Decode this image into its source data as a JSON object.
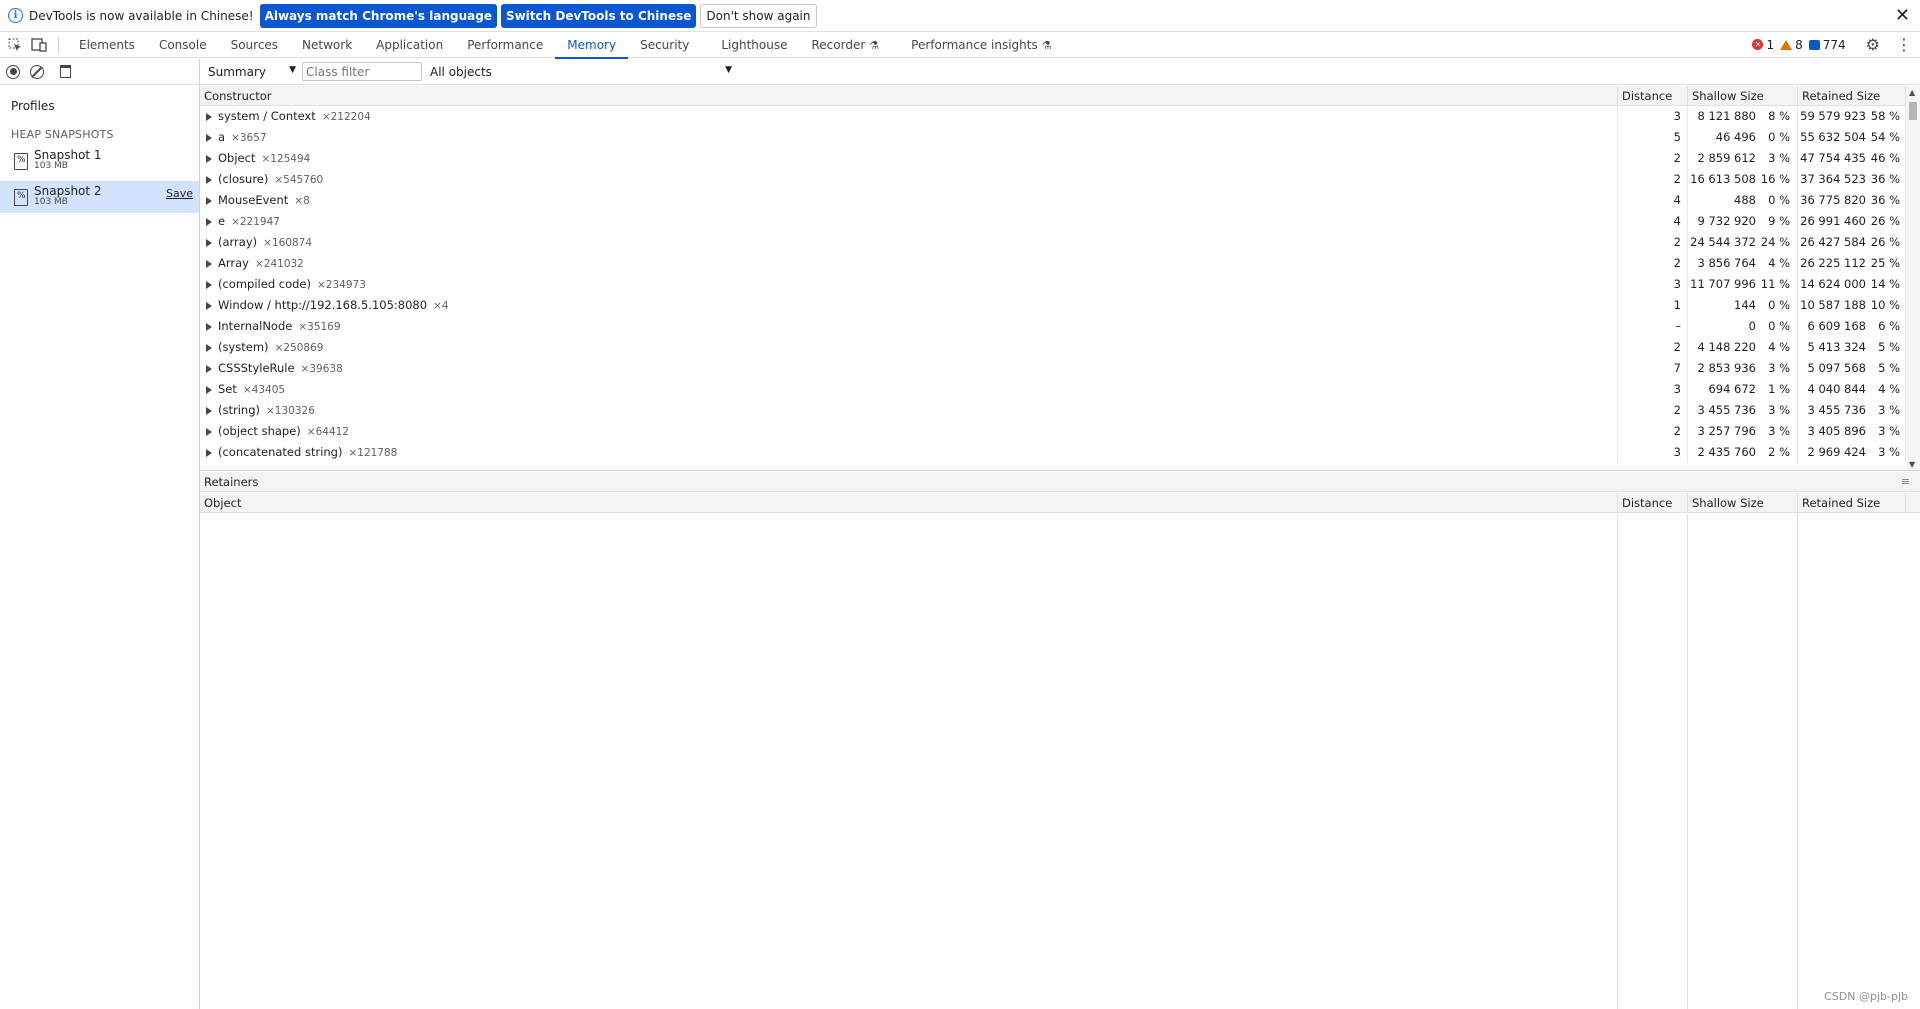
{
  "infobar": {
    "message": "DevTools is now available in Chinese!",
    "btn_match": "Always match Chrome's language",
    "btn_switch": "Switch DevTools to Chinese",
    "btn_dismiss": "Don't show again",
    "close": "✕"
  },
  "tabs": [
    "Elements",
    "Console",
    "Sources",
    "Network",
    "Application",
    "Performance",
    "Memory",
    "Security",
    "Lighthouse",
    "Recorder",
    "Performance insights"
  ],
  "active_tab": "Memory",
  "status": {
    "errors": "1",
    "warnings": "8",
    "messages": "774"
  },
  "sidebar": {
    "profiles": "Profiles",
    "heap_title": "HEAP SNAPSHOTS",
    "snapshots": [
      {
        "name": "Snapshot 1",
        "size": "103 MB"
      },
      {
        "name": "Snapshot 2",
        "size": "103 MB",
        "save": "Save"
      }
    ]
  },
  "toolbar": {
    "view": "Summary",
    "filter_placeholder": "Class filter",
    "objects": "All objects"
  },
  "columns": {
    "constructor": "Constructor",
    "distance": "Distance",
    "shallow": "Shallow Size",
    "retained": "Retained Size"
  },
  "rows": [
    {
      "name": "system / Context",
      "count": "×212204",
      "distance": "3",
      "shallow": "8 121 880",
      "shallow_pct": "8 %",
      "retained": "59 579 923",
      "retained_pct": "58 %"
    },
    {
      "name": "a",
      "count": "×3657",
      "distance": "5",
      "shallow": "46 496",
      "shallow_pct": "0 %",
      "retained": "55 632 504",
      "retained_pct": "54 %"
    },
    {
      "name": "Object",
      "count": "×125494",
      "distance": "2",
      "shallow": "2 859 612",
      "shallow_pct": "3 %",
      "retained": "47 754 435",
      "retained_pct": "46 %"
    },
    {
      "name": "(closure)",
      "count": "×545760",
      "distance": "2",
      "shallow": "16 613 508",
      "shallow_pct": "16 %",
      "retained": "37 364 523",
      "retained_pct": "36 %"
    },
    {
      "name": "MouseEvent",
      "count": "×8",
      "distance": "4",
      "shallow": "488",
      "shallow_pct": "0 %",
      "retained": "36 775 820",
      "retained_pct": "36 %"
    },
    {
      "name": "e",
      "count": "×221947",
      "distance": "4",
      "shallow": "9 732 920",
      "shallow_pct": "9 %",
      "retained": "26 991 460",
      "retained_pct": "26 %"
    },
    {
      "name": "(array)",
      "count": "×160874",
      "distance": "2",
      "shallow": "24 544 372",
      "shallow_pct": "24 %",
      "retained": "26 427 584",
      "retained_pct": "26 %"
    },
    {
      "name": "Array",
      "count": "×241032",
      "distance": "2",
      "shallow": "3 856 764",
      "shallow_pct": "4 %",
      "retained": "26 225 112",
      "retained_pct": "25 %"
    },
    {
      "name": "(compiled code)",
      "count": "×234973",
      "distance": "3",
      "shallow": "11 707 996",
      "shallow_pct": "11 %",
      "retained": "14 624 000",
      "retained_pct": "14 %"
    },
    {
      "name": "Window / http://192.168.5.105:8080",
      "count": "×4",
      "distance": "1",
      "shallow": "144",
      "shallow_pct": "0 %",
      "retained": "10 587 188",
      "retained_pct": "10 %"
    },
    {
      "name": "InternalNode",
      "count": "×35169",
      "distance": "–",
      "shallow": "0",
      "shallow_pct": "0 %",
      "retained": "6 609 168",
      "retained_pct": "6 %"
    },
    {
      "name": "(system)",
      "count": "×250869",
      "distance": "2",
      "shallow": "4 148 220",
      "shallow_pct": "4 %",
      "retained": "5 413 324",
      "retained_pct": "5 %"
    },
    {
      "name": "CSSStyleRule",
      "count": "×39638",
      "distance": "7",
      "shallow": "2 853 936",
      "shallow_pct": "3 %",
      "retained": "5 097 568",
      "retained_pct": "5 %"
    },
    {
      "name": "Set",
      "count": "×43405",
      "distance": "3",
      "shallow": "694 672",
      "shallow_pct": "1 %",
      "retained": "4 040 844",
      "retained_pct": "4 %"
    },
    {
      "name": "(string)",
      "count": "×130326",
      "distance": "2",
      "shallow": "3 455 736",
      "shallow_pct": "3 %",
      "retained": "3 455 736",
      "retained_pct": "3 %"
    },
    {
      "name": "(object shape)",
      "count": "×64412",
      "distance": "2",
      "shallow": "3 257 796",
      "shallow_pct": "3 %",
      "retained": "3 405 896",
      "retained_pct": "3 %"
    },
    {
      "name": "(concatenated string)",
      "count": "×121788",
      "distance": "3",
      "shallow": "2 435 760",
      "shallow_pct": "2 %",
      "retained": "2 969 424",
      "retained_pct": "3 %"
    }
  ],
  "retainers": {
    "title": "Retainers",
    "object": "Object",
    "distance": "Distance",
    "shallow": "Shallow Size",
    "retained": "Retained Size"
  },
  "watermark": "CSDN @pjb-pjb",
  "colors": {
    "accent": "#0b57d0",
    "error": "#dc362e",
    "warning": "#e37400",
    "selected": "#d3e3fd"
  }
}
